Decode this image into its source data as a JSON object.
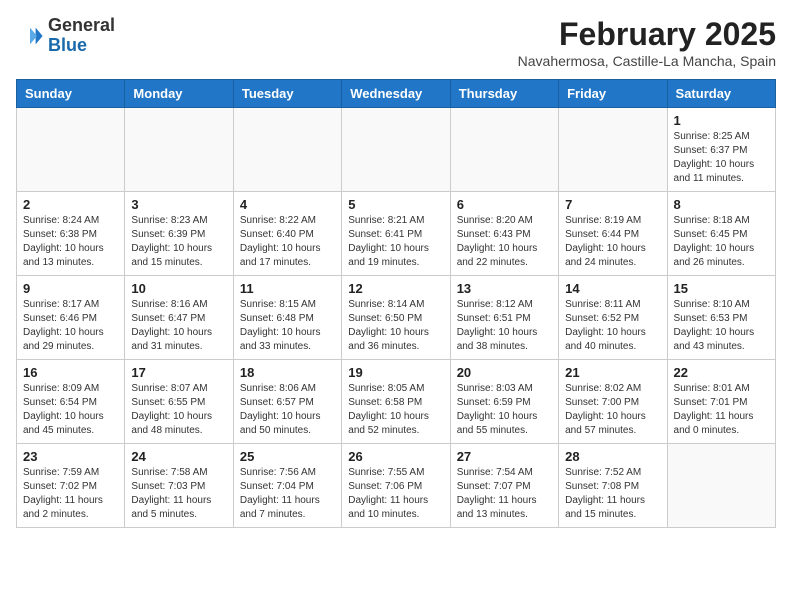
{
  "header": {
    "logo": {
      "general": "General",
      "blue": "Blue"
    },
    "title": "February 2025",
    "subtitle": "Navahermosa, Castille-La Mancha, Spain"
  },
  "calendar": {
    "days_of_week": [
      "Sunday",
      "Monday",
      "Tuesday",
      "Wednesday",
      "Thursday",
      "Friday",
      "Saturday"
    ],
    "weeks": [
      [
        {
          "day": "",
          "info": ""
        },
        {
          "day": "",
          "info": ""
        },
        {
          "day": "",
          "info": ""
        },
        {
          "day": "",
          "info": ""
        },
        {
          "day": "",
          "info": ""
        },
        {
          "day": "",
          "info": ""
        },
        {
          "day": "1",
          "info": "Sunrise: 8:25 AM\nSunset: 6:37 PM\nDaylight: 10 hours\nand 11 minutes."
        }
      ],
      [
        {
          "day": "2",
          "info": "Sunrise: 8:24 AM\nSunset: 6:38 PM\nDaylight: 10 hours\nand 13 minutes."
        },
        {
          "day": "3",
          "info": "Sunrise: 8:23 AM\nSunset: 6:39 PM\nDaylight: 10 hours\nand 15 minutes."
        },
        {
          "day": "4",
          "info": "Sunrise: 8:22 AM\nSunset: 6:40 PM\nDaylight: 10 hours\nand 17 minutes."
        },
        {
          "day": "5",
          "info": "Sunrise: 8:21 AM\nSunset: 6:41 PM\nDaylight: 10 hours\nand 19 minutes."
        },
        {
          "day": "6",
          "info": "Sunrise: 8:20 AM\nSunset: 6:43 PM\nDaylight: 10 hours\nand 22 minutes."
        },
        {
          "day": "7",
          "info": "Sunrise: 8:19 AM\nSunset: 6:44 PM\nDaylight: 10 hours\nand 24 minutes."
        },
        {
          "day": "8",
          "info": "Sunrise: 8:18 AM\nSunset: 6:45 PM\nDaylight: 10 hours\nand 26 minutes."
        }
      ],
      [
        {
          "day": "9",
          "info": "Sunrise: 8:17 AM\nSunset: 6:46 PM\nDaylight: 10 hours\nand 29 minutes."
        },
        {
          "day": "10",
          "info": "Sunrise: 8:16 AM\nSunset: 6:47 PM\nDaylight: 10 hours\nand 31 minutes."
        },
        {
          "day": "11",
          "info": "Sunrise: 8:15 AM\nSunset: 6:48 PM\nDaylight: 10 hours\nand 33 minutes."
        },
        {
          "day": "12",
          "info": "Sunrise: 8:14 AM\nSunset: 6:50 PM\nDaylight: 10 hours\nand 36 minutes."
        },
        {
          "day": "13",
          "info": "Sunrise: 8:12 AM\nSunset: 6:51 PM\nDaylight: 10 hours\nand 38 minutes."
        },
        {
          "day": "14",
          "info": "Sunrise: 8:11 AM\nSunset: 6:52 PM\nDaylight: 10 hours\nand 40 minutes."
        },
        {
          "day": "15",
          "info": "Sunrise: 8:10 AM\nSunset: 6:53 PM\nDaylight: 10 hours\nand 43 minutes."
        }
      ],
      [
        {
          "day": "16",
          "info": "Sunrise: 8:09 AM\nSunset: 6:54 PM\nDaylight: 10 hours\nand 45 minutes."
        },
        {
          "day": "17",
          "info": "Sunrise: 8:07 AM\nSunset: 6:55 PM\nDaylight: 10 hours\nand 48 minutes."
        },
        {
          "day": "18",
          "info": "Sunrise: 8:06 AM\nSunset: 6:57 PM\nDaylight: 10 hours\nand 50 minutes."
        },
        {
          "day": "19",
          "info": "Sunrise: 8:05 AM\nSunset: 6:58 PM\nDaylight: 10 hours\nand 52 minutes."
        },
        {
          "day": "20",
          "info": "Sunrise: 8:03 AM\nSunset: 6:59 PM\nDaylight: 10 hours\nand 55 minutes."
        },
        {
          "day": "21",
          "info": "Sunrise: 8:02 AM\nSunset: 7:00 PM\nDaylight: 10 hours\nand 57 minutes."
        },
        {
          "day": "22",
          "info": "Sunrise: 8:01 AM\nSunset: 7:01 PM\nDaylight: 11 hours\nand 0 minutes."
        }
      ],
      [
        {
          "day": "23",
          "info": "Sunrise: 7:59 AM\nSunset: 7:02 PM\nDaylight: 11 hours\nand 2 minutes."
        },
        {
          "day": "24",
          "info": "Sunrise: 7:58 AM\nSunset: 7:03 PM\nDaylight: 11 hours\nand 5 minutes."
        },
        {
          "day": "25",
          "info": "Sunrise: 7:56 AM\nSunset: 7:04 PM\nDaylight: 11 hours\nand 7 minutes."
        },
        {
          "day": "26",
          "info": "Sunrise: 7:55 AM\nSunset: 7:06 PM\nDaylight: 11 hours\nand 10 minutes."
        },
        {
          "day": "27",
          "info": "Sunrise: 7:54 AM\nSunset: 7:07 PM\nDaylight: 11 hours\nand 13 minutes."
        },
        {
          "day": "28",
          "info": "Sunrise: 7:52 AM\nSunset: 7:08 PM\nDaylight: 11 hours\nand 15 minutes."
        },
        {
          "day": "",
          "info": ""
        }
      ]
    ]
  }
}
